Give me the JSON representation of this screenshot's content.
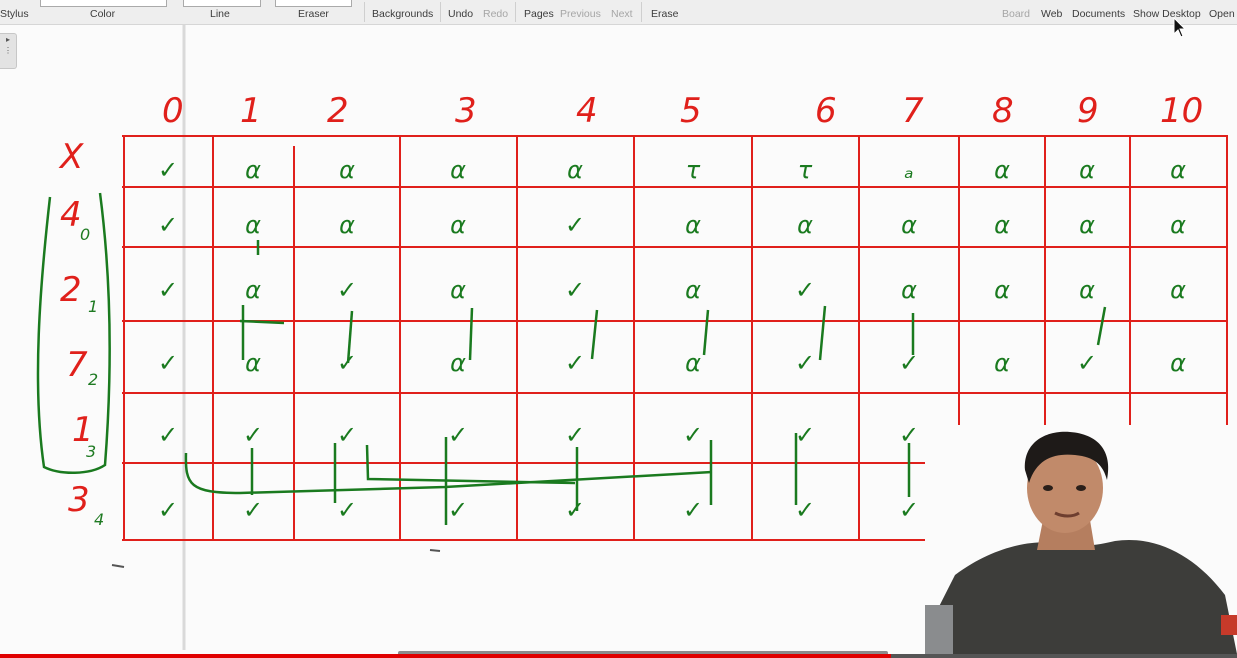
{
  "toolbar": {
    "left_items": [
      {
        "label": "Stylus",
        "enabled": true
      },
      {
        "label": "Color",
        "enabled": true
      },
      {
        "label": "Line",
        "enabled": true
      },
      {
        "label": "Eraser",
        "enabled": true
      },
      {
        "label": "Backgrounds",
        "enabled": true
      },
      {
        "label": "Undo",
        "enabled": true
      },
      {
        "label": "Redo",
        "enabled": false
      },
      {
        "label": "Pages",
        "enabled": true
      },
      {
        "label": "Previous",
        "enabled": false
      },
      {
        "label": "Next",
        "enabled": false
      },
      {
        "label": "Erase",
        "enabled": true
      }
    ],
    "right_items": [
      {
        "label": "Board",
        "enabled": false
      },
      {
        "label": "Web",
        "enabled": true
      },
      {
        "label": "Documents",
        "enabled": true
      },
      {
        "label": "Show Desktop",
        "enabled": true
      },
      {
        "label": "Open",
        "enabled": true
      }
    ]
  },
  "whiteboard": {
    "column_headers": [
      "0",
      "1",
      "2",
      "3",
      "4",
      "5",
      "6",
      "7",
      "8",
      "9",
      "10"
    ],
    "rows": [
      {
        "label": "X",
        "sub": ""
      },
      {
        "label": "4",
        "sub": "0"
      },
      {
        "label": "2",
        "sub": "1"
      },
      {
        "label": "7",
        "sub": "2"
      },
      {
        "label": "1",
        "sub": "3"
      },
      {
        "label": "3",
        "sub": "4"
      }
    ],
    "cells": [
      [
        "✓",
        "α",
        "α",
        "α",
        "α",
        "τ",
        "τ",
        "ₐ",
        "α",
        "α",
        "α"
      ],
      [
        "✓",
        "α",
        "α",
        "α",
        "✓",
        "α",
        "α",
        "α",
        "α",
        "α",
        "α"
      ],
      [
        "✓",
        "α",
        "✓",
        "α",
        "✓",
        "α",
        "✓",
        "α",
        "α",
        "α",
        "α"
      ],
      [
        "✓",
        "α",
        "✓",
        "α",
        "✓",
        "α",
        "✓",
        "✓",
        "α",
        "✓",
        "α"
      ],
      [
        "✓",
        "✓",
        "✓",
        "✓",
        "✓",
        "✓",
        "✓",
        "✓",
        "✓",
        "✓",
        "✓"
      ],
      [
        "✓",
        "✓",
        "✓",
        "✓",
        "✓",
        "✓",
        "✓",
        "✓",
        "✓",
        "",
        "✓"
      ]
    ]
  },
  "colors": {
    "grid": "#e0201b",
    "ink_green": "#1a7a1f",
    "toolbar_bg": "#eeeeee",
    "progress_played": "#e00000"
  },
  "video": {
    "played_fraction": 0.72
  }
}
